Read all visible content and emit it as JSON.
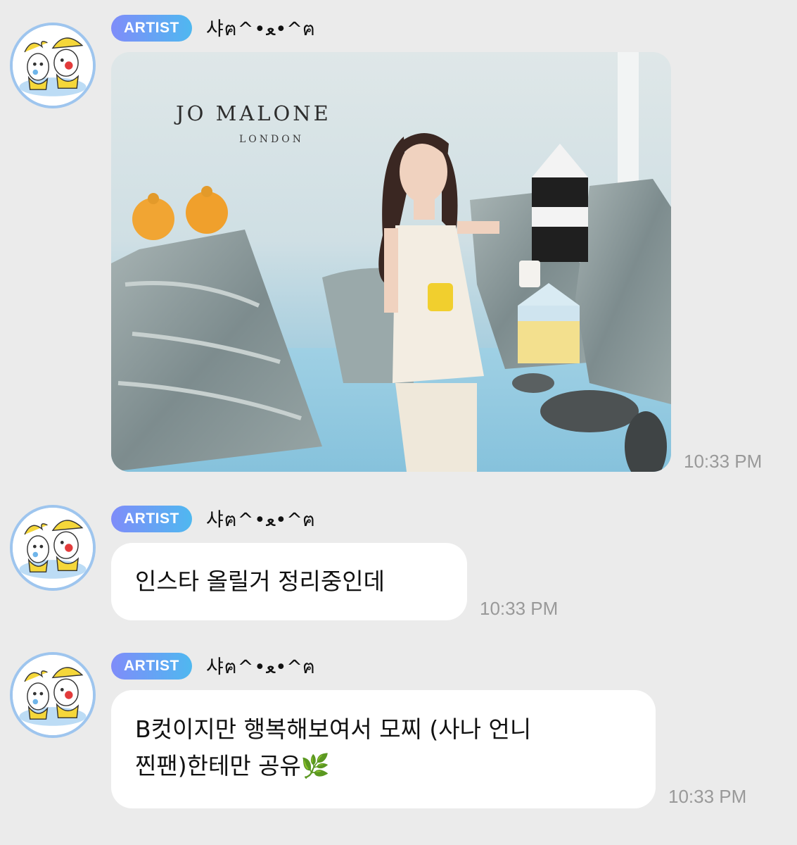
{
  "messages": [
    {
      "badge": "ARTIST",
      "sender": "샤ฅ^•ﻌ•^ฅ",
      "type": "image",
      "image": {
        "brand": "JO MALONE",
        "brand_sub": "LONDON"
      },
      "time": "10:33 PM"
    },
    {
      "badge": "ARTIST",
      "sender": "샤ฅ^•ﻌ•^ฅ",
      "type": "text",
      "text": "인스타 올릴거 정리중인데",
      "time": "10:33 PM"
    },
    {
      "badge": "ARTIST",
      "sender": "샤ฅ^•ﻌ•^ฅ",
      "type": "text",
      "text_line1": "B컷이지만 행복해보여서 모찌 (사나 언니",
      "text_line2": "찐팬)한테만 공유",
      "emoji": "🌿",
      "emoji_icon": "herb-icon",
      "time": "10:33 PM"
    }
  ],
  "colors": {
    "background": "#ebebeb",
    "bubble": "#ffffff",
    "badge_start": "#7f8cf9",
    "badge_end": "#4fb8f0",
    "timestamp": "#999999",
    "avatar_ring": "#9ec5ee"
  }
}
